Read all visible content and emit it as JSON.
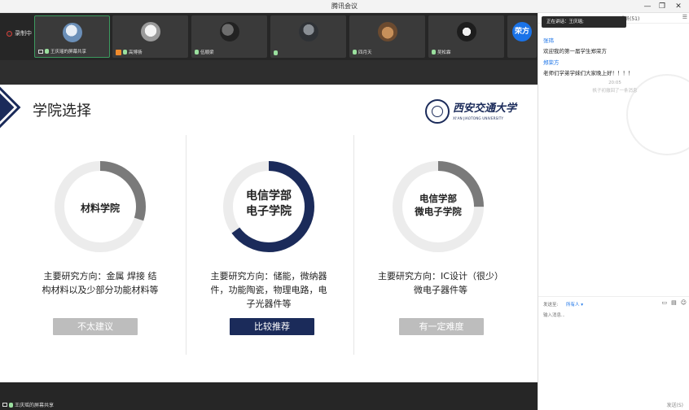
{
  "window": {
    "title": "腾讯会议"
  },
  "record": {
    "label": "录制中"
  },
  "participants": [
    {
      "name": "王庆瑶的屏幕共享",
      "avatar": "a1"
    },
    {
      "name": "高博扬",
      "avatar": "a2"
    },
    {
      "name": "伍顺梁",
      "avatar": "a3"
    },
    {
      "name": "",
      "avatar": "a4"
    },
    {
      "name": "四月天",
      "avatar": "a5"
    },
    {
      "name": "吴松霖",
      "avatar": "a6"
    },
    {
      "name": "郑荣方",
      "avatar": "a7",
      "initials": "荣方"
    }
  ],
  "slide": {
    "title": "学院选择",
    "logo_cn": "西安交通大学",
    "logo_en": "XI'AN JIAOTONG UNIVERSITY",
    "colleges": [
      {
        "name_line1": "材料学院",
        "name_line2": "",
        "desc_line1": "主要研究方向：金属 焊接 结",
        "desc_line2": "构材料以及少部分功能材料等",
        "desc_line3": "",
        "tag": "不太建议",
        "fill": 0.3
      },
      {
        "name_line1": "电信学部",
        "name_line2": "电子学院",
        "desc_line1": "主要研究方向：储能，微纳器",
        "desc_line2": "件，功能陶瓷，物理电路，电",
        "desc_line3": "子光器件等",
        "tag": "比较推荐",
        "fill": 0.65
      },
      {
        "name_line1": "电信学部",
        "name_line2": "微电子学院",
        "desc_line1": "主要研究方向：IC设计（很少）",
        "desc_line2": "微电子器件等",
        "desc_line3": "",
        "tag": "有一定难度",
        "fill": 0.25
      }
    ]
  },
  "share_bar": {
    "label": "王庆瑶的屏幕共享"
  },
  "chat": {
    "speaking": "正在讲话：王庆瑶;",
    "members": "成员(51)",
    "messages": [
      {
        "name": "张玮",
        "text": "欢迎我的第一届学生郑荣方"
      },
      {
        "name": "郑荣方",
        "text": "老师们学弟学妹们大家晚上好！！！！"
      }
    ],
    "timestamp": "20:05",
    "recall": "帆子初撤回了一条消息",
    "to_label": "发送至:",
    "to_value": "所有人 ▾",
    "input_placeholder": "输入消息...",
    "send_label": "发送(S)"
  }
}
